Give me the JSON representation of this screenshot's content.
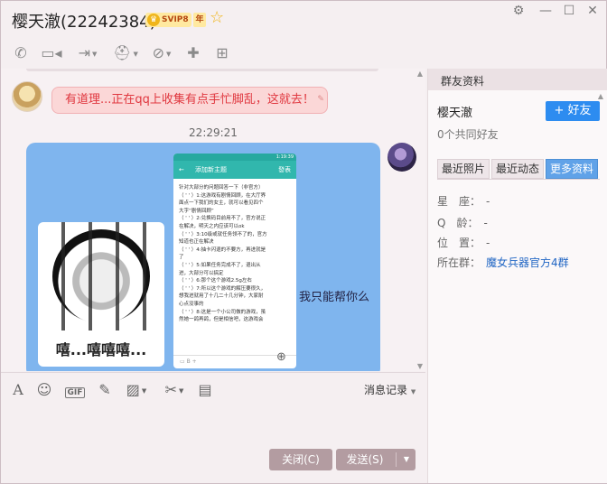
{
  "window": {
    "title_name": "樱天澈(22242384)",
    "svip_label": "SVIP8",
    "year_label": "年",
    "controls": {
      "settings": "⚙",
      "minimize": "—",
      "maximize": "☐",
      "close": "✕"
    }
  },
  "toolbar": {
    "items": [
      {
        "name": "phone-icon",
        "glyph": "📞"
      },
      {
        "name": "video-icon",
        "glyph": "▭"
      },
      {
        "name": "share-screen-icon",
        "glyph": "⇥"
      },
      {
        "name": "file-icon",
        "glyph": "▣"
      },
      {
        "name": "remote-icon",
        "glyph": "⛑"
      },
      {
        "name": "block-user-icon",
        "glyph": "⊘"
      },
      {
        "name": "add-user-icon",
        "glyph": "✚"
      },
      {
        "name": "new-window-icon",
        "glyph": "⊞"
      }
    ]
  },
  "chat": {
    "message1": "有道理...正在qq上收集有点手忙脚乱，这就去！",
    "timestamp": "22:29:21",
    "meme_caption": "嘻...嘻嘻嘻...",
    "phone": {
      "status": "1:19:39",
      "back": "←",
      "title": "添加新主题",
      "send": "發表",
      "lines": [
        "针对大部分的问题回答一下（非官方）",
        "（ ' ' ）1:这游戏有剧情回顾，在大厅界",
        "面点一下我们的女主，就可以看见四个",
        "大字“剧情回顾”",
        "（ ' ' ）2:兑换码目前用不了，官方说正",
        "在解决，明天之内应该可以ok",
        "（ ' ' ）3:10级或就任务领不了的，官方",
        "知道也正在解决",
        "（ ' ' ）4:抽卡闪退的不要方，再进就是",
        "了",
        "（ ' ' ）5:如果任务完成不了，退出从",
        "进，大部分可以搞定",
        "（ ' ' ）6:那个这个游戏2.5g左右",
        "（ ' ' ）7:所以这个游戏的解压要很久，",
        "想我进就用了十几二十几分钟，大家耐",
        "心点没事的",
        "（ ' ' ）8:这是一个小公司做的游戏，虽",
        "然她一鸽再鸽，但是相信吧，这游戏会"
      ],
      "bottom_tools": "▭   B   +"
    },
    "message2_caption": "我只能帮你么"
  },
  "input_toolbar": {
    "history_label": "消息记录"
  },
  "buttons": {
    "close": "关闭(C)",
    "send": "发送(S)"
  },
  "panel": {
    "header": "群友资料",
    "friend_name": "樱天澈",
    "add_friend": "+ 好友",
    "common_friends": "0个共同好友",
    "tabs": [
      "最近照片",
      "最近动态",
      "更多资料"
    ],
    "info": {
      "constellation_label": "星　座：",
      "constellation_value": "-",
      "age_label": "Q　龄：",
      "age_value": "-",
      "location_label": "位　置：",
      "location_value": "-",
      "group_label": "所在群：",
      "group_value": "魔女兵器官方4群"
    }
  }
}
